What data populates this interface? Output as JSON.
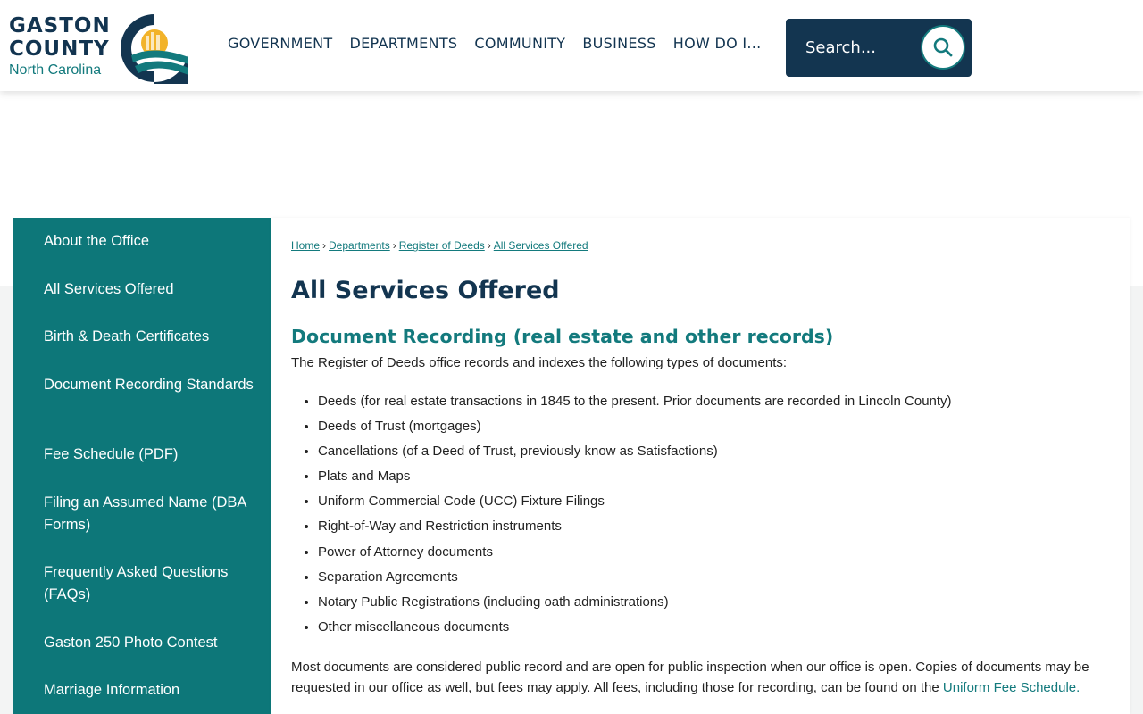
{
  "header": {
    "logo": {
      "line1": "GASTON",
      "line2": "COUNTY",
      "line3": "North Carolina"
    },
    "nav": [
      "GOVERNMENT",
      "DEPARTMENTS",
      "COMMUNITY",
      "BUSINESS",
      "HOW DO I..."
    ],
    "search": {
      "placeholder": "Search..."
    }
  },
  "sidebar": {
    "items": [
      {
        "label": "About the Office"
      },
      {
        "label": "All Services Offered"
      },
      {
        "label": "Birth & Death Certificates"
      },
      {
        "label": "Document Recording Standards"
      },
      {
        "label": "Fee Schedule (PDF)"
      },
      {
        "label": "Filing an Assumed Name (DBA Forms)"
      },
      {
        "label": "Frequently Asked Questions (FAQs)"
      },
      {
        "label": "Gaston 250 Photo Contest"
      },
      {
        "label": "Marriage Information"
      }
    ]
  },
  "breadcrumb": {
    "home": "Home",
    "departments": "Departments",
    "register": "Register of Deeds",
    "current": "All Services Offered",
    "sep": "›"
  },
  "main": {
    "title": "All Services Offered",
    "section_title": "Document Recording (real estate and other records)",
    "intro": "The Register of Deeds office records and indexes the following types of documents:",
    "documents": [
      "Deeds (for real estate transactions in 1845 to the present. Prior documents are recorded in Lincoln County)",
      "Deeds of Trust (mortgages)",
      "Cancellations (of a Deed of Trust, previously know as Satisfactions)",
      "Plats and Maps",
      "Uniform Commercial Code (UCC) Fixture Filings",
      "Right-of-Way and Restriction instruments",
      "Power of Attorney documents",
      "Separation Agreements",
      "Notary Public Registrations (including oath administrations)",
      "Other miscellaneous documents"
    ],
    "para_text": "Most documents are considered public record and are open for public inspection when our office is open. Copies of documents may be requested in our office as well, but fees may apply. All fees, including those for recording, can be found on the ",
    "para_link": "Uniform Fee Schedule."
  },
  "colors": {
    "navy": "#133550",
    "teal": "#0d7779",
    "accent": "#137a7d",
    "gold": "#f2b32a"
  }
}
